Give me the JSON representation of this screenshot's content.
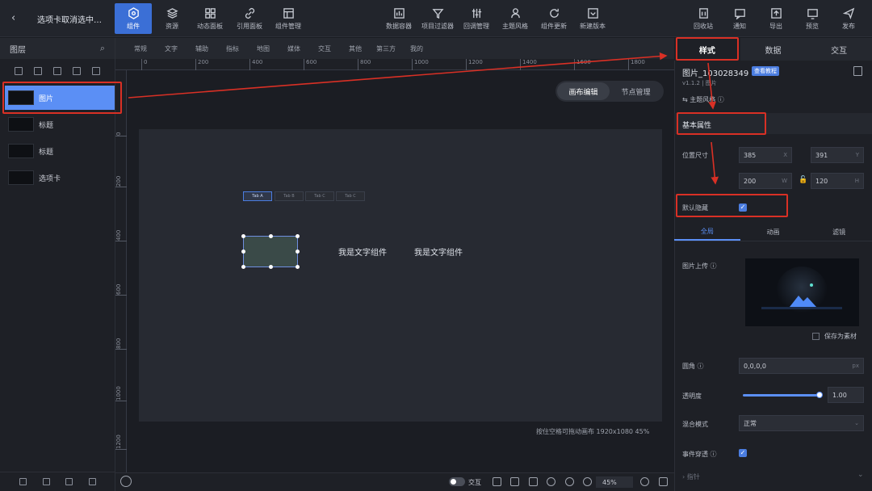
{
  "app": {
    "title": "选项卡取消选中…"
  },
  "toolbar": {
    "left": [
      {
        "label": "组件",
        "icon": "component-icon"
      },
      {
        "label": "资源",
        "icon": "layers-icon"
      },
      {
        "label": "动态面板",
        "icon": "panel-icon"
      },
      {
        "label": "引用面板",
        "icon": "link-icon"
      },
      {
        "label": "组件管理",
        "icon": "manage-icon"
      }
    ],
    "center": [
      {
        "label": "数据容器",
        "icon": "data-container-icon"
      },
      {
        "label": "项目过滤器",
        "icon": "filter-icon"
      },
      {
        "label": "回调管理",
        "icon": "callback-icon"
      },
      {
        "label": "主题风格",
        "icon": "theme-icon"
      },
      {
        "label": "组件更新",
        "icon": "refresh-icon"
      },
      {
        "label": "新建版本",
        "icon": "version-icon"
      }
    ],
    "right": [
      {
        "label": "回收站",
        "icon": "trash-icon"
      },
      {
        "label": "通知",
        "icon": "notify-icon"
      },
      {
        "label": "导出",
        "icon": "export-icon"
      },
      {
        "label": "预览",
        "icon": "preview-icon"
      },
      {
        "label": "发布",
        "icon": "publish-icon"
      }
    ]
  },
  "sidebar": {
    "title": "图层",
    "layers": [
      {
        "label": "图片",
        "selected": true
      },
      {
        "label": "标题"
      },
      {
        "label": "标题"
      },
      {
        "label": "选项卡"
      }
    ]
  },
  "categories": [
    "常规",
    "文字",
    "辅助",
    "指标",
    "地图",
    "媒体",
    "交互",
    "其他",
    "第三方",
    "我的"
  ],
  "ruler": {
    "h": [
      "0",
      "200",
      "400",
      "600",
      "800",
      "1000",
      "1200",
      "1400",
      "1600",
      "1800"
    ],
    "v": [
      "0",
      "200",
      "400",
      "600",
      "800",
      "1000",
      "1200"
    ]
  },
  "edit_toggle": {
    "a": "画布编辑",
    "b": "节点管理"
  },
  "canvas": {
    "tabs": [
      "Tab A",
      "Tab B",
      "Tab C",
      "Tab C"
    ],
    "text1": "我是文字组件",
    "text2": "我是文字组件",
    "info": "按住空格可拖动画布   1920x1080  45%"
  },
  "bottombar": {
    "interact": "交互",
    "zoom": "45%"
  },
  "panel": {
    "tabs": [
      "样式",
      "数据",
      "交互"
    ],
    "component_name": "图片_103028349",
    "tutorial_badge": "查看教程",
    "version": "v1.1.2 | 图片",
    "theme_style": "主题风格",
    "basic_props": "基本属性",
    "position_size": "位置尺寸",
    "x": "385",
    "y": "391",
    "w": "200",
    "h": "120",
    "default_hidden": "默认隐藏",
    "subtabs": [
      "全局",
      "动画",
      "滤镜"
    ],
    "image_upload": "图片上传",
    "save_material": "保存为素材",
    "corner": "圆角",
    "corner_value": "0,0,0,0",
    "corner_unit": "px",
    "opacity": "透明度",
    "opacity_value": "1.00",
    "opacity_fraction": 1.0,
    "blend_mode": "混合模式",
    "blend_value": "正常",
    "event_through": "事件穿透",
    "pointer": "指针"
  },
  "colors": {
    "accent": "#4b7de0",
    "annotation": "#d93025",
    "selected_layer": "#5b8ff5"
  }
}
